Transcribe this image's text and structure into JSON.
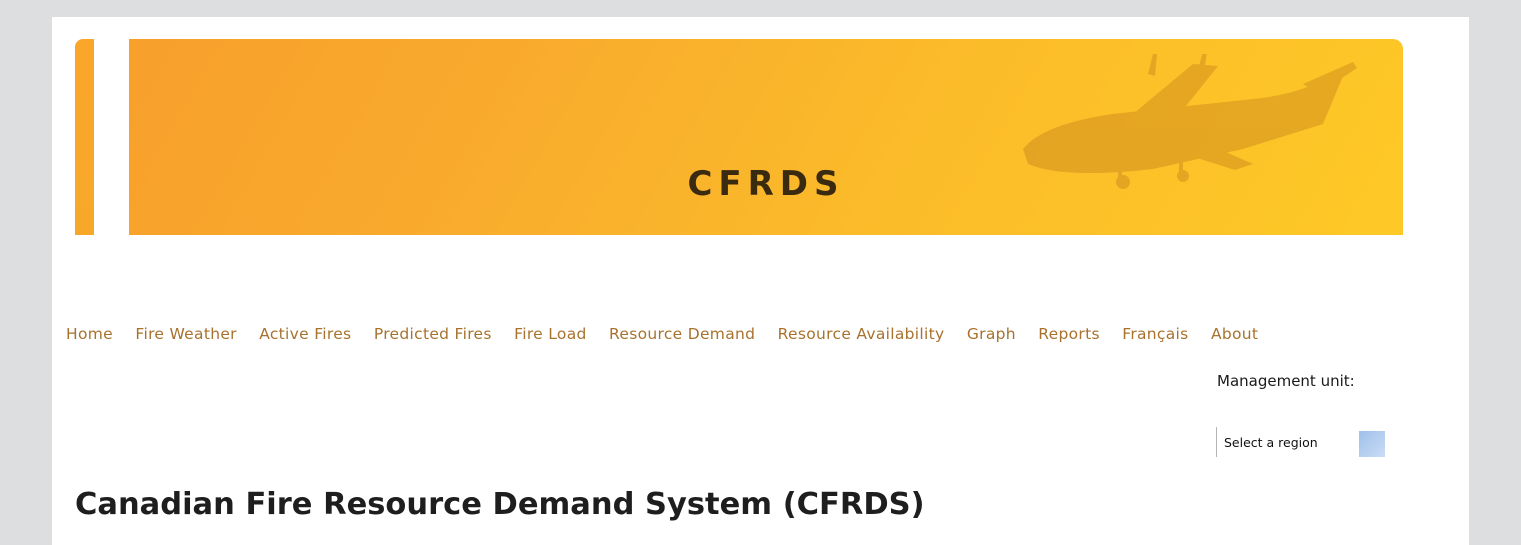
{
  "banner": {
    "title": "CFRDS"
  },
  "nav": {
    "items": [
      {
        "label": "Home"
      },
      {
        "label": "Fire Weather"
      },
      {
        "label": "Active Fires"
      },
      {
        "label": "Predicted Fires"
      },
      {
        "label": "Fire Load"
      },
      {
        "label": "Resource Demand"
      },
      {
        "label": "Resource Availability"
      },
      {
        "label": "Graph"
      },
      {
        "label": "Reports"
      },
      {
        "label": "Français"
      },
      {
        "label": "About"
      }
    ]
  },
  "management_unit": {
    "label": "Management unit:",
    "select_value": "Select a region"
  },
  "main": {
    "title": "Canadian Fire Resource Demand System (CFRDS)"
  },
  "colors": {
    "nav_link": "#a8722e",
    "banner_start": "#f7a02c",
    "banner_end": "#fec926",
    "title_text": "#1e1e1e"
  }
}
